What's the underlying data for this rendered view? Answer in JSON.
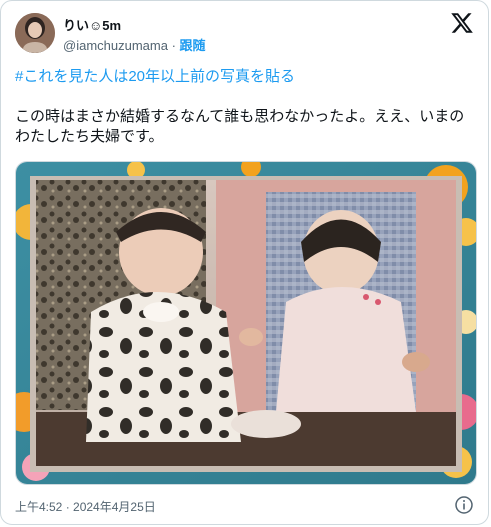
{
  "author": {
    "display_name": "りい☺︎5m",
    "handle": "@iamchuzumama",
    "separator": "·",
    "follow_label": "跟随"
  },
  "tweet": {
    "hashtag": "#これを見た人は20年以上前の写真を貼る",
    "text": "この時はまさか結婚するなんて誰も思わなかったよ。ええ、いまのわたしたち夫婦です。",
    "timestamp": "上午4:52 · 2024年4月25日"
  },
  "icons": {
    "brand": "x-logo-icon",
    "info": "info-icon"
  },
  "colors": {
    "link": "#1d9bf0",
    "text": "#0f1419",
    "secondary": "#536471",
    "border": "#cfd9de"
  }
}
